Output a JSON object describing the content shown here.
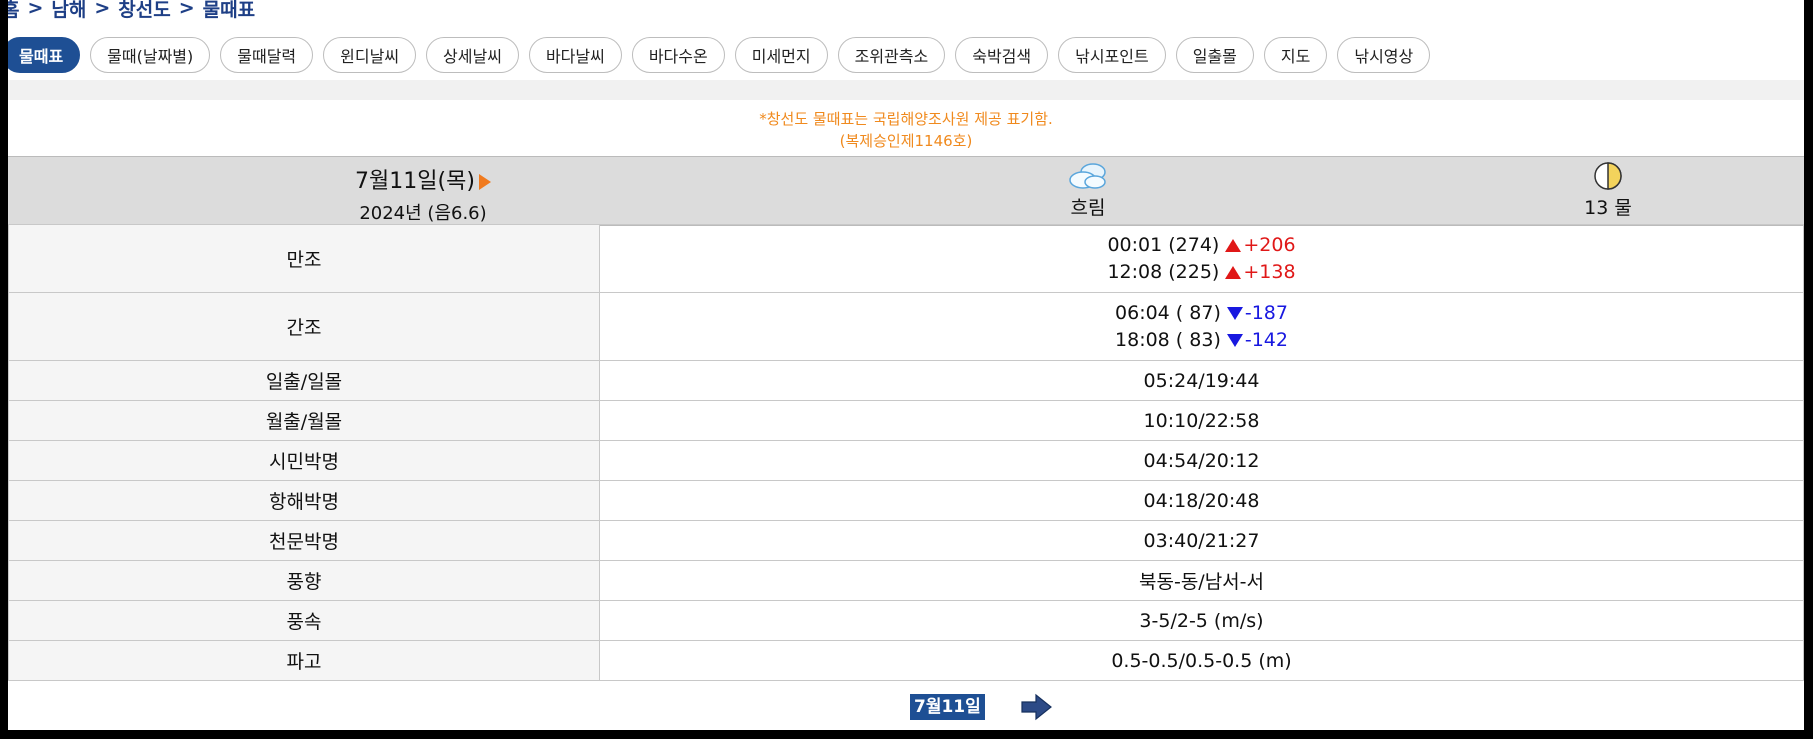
{
  "breadcrumb": [
    "홈",
    "남해",
    "창선도",
    "물때표"
  ],
  "tabs": [
    {
      "label": "물때표",
      "active": true
    },
    {
      "label": "물때(날짜별)",
      "active": false
    },
    {
      "label": "물때달력",
      "active": false
    },
    {
      "label": "윈디날씨",
      "active": false
    },
    {
      "label": "상세날씨",
      "active": false
    },
    {
      "label": "바다날씨",
      "active": false
    },
    {
      "label": "바다수온",
      "active": false
    },
    {
      "label": "미세먼지",
      "active": false
    },
    {
      "label": "조위관측소",
      "active": false
    },
    {
      "label": "숙박검색",
      "active": false
    },
    {
      "label": "낚시포인트",
      "active": false
    },
    {
      "label": "일출몰",
      "active": false
    },
    {
      "label": "지도",
      "active": false
    },
    {
      "label": "낚시영상",
      "active": false
    }
  ],
  "notice": {
    "line1": "*창선도 물때표는 국립해양조사원 제공 표기함.",
    "line2": "(복제승인제1146호)"
  },
  "day": {
    "date": "7월11일(목)",
    "year_lunar": "2024년 (음6.6)",
    "weather_icon": "cloudy-icon",
    "weather": "흐림",
    "moon_icon": "half-moon-icon",
    "tide_phase": "13 물"
  },
  "rows": {
    "high_tide": {
      "label": "만조",
      "entries": [
        {
          "time": "00:01 (274)",
          "diff": "+206"
        },
        {
          "time": "12:08 (225)",
          "diff": "+138"
        }
      ]
    },
    "low_tide": {
      "label": "간조",
      "entries": [
        {
          "time": "06:04 ( 87)",
          "diff": "-187"
        },
        {
          "time": "18:08 ( 83)",
          "diff": "-142"
        }
      ]
    },
    "sunrise_sunset": {
      "label": "일출/일몰",
      "value": "05:24/19:44"
    },
    "moonrise_moonset": {
      "label": "월출/월몰",
      "value": "10:10/22:58"
    },
    "civil_twilight": {
      "label": "시민박명",
      "value": "04:54/20:12"
    },
    "nautical_twilight": {
      "label": "항해박명",
      "value": "04:18/20:48"
    },
    "astronomical_twilight": {
      "label": "천문박명",
      "value": "03:40/21:27"
    },
    "wind_direction": {
      "label": "풍향",
      "value": "북동-동/남서-서"
    },
    "wind_speed": {
      "label": "풍속",
      "value": "3-5/2-5 (m/s)"
    },
    "wave_height": {
      "label": "파고",
      "value": "0.5-0.5/0.5-0.5 (m)"
    }
  },
  "footer": {
    "current_date": "7월11일",
    "next_icon": "next-arrow-icon"
  },
  "colors": {
    "accent": "#1e4f94",
    "notice": "#f08a1e",
    "rise": "#e01818",
    "fall": "#1818e0",
    "header_bg": "#dcdcdc"
  }
}
